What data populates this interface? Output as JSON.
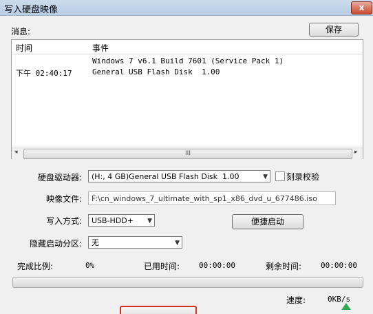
{
  "window": {
    "title": "写入硬盘映像",
    "close_glyph": "x"
  },
  "messages": {
    "label": "消息:",
    "save_label": "保存",
    "columns": [
      "时间",
      "事件"
    ],
    "rows": [
      {
        "time": "",
        "event": "Windows 7 v6.1 Build 7601 (Service Pack 1)"
      },
      {
        "time": "下午 02:40:17",
        "event": "General USB Flash Disk  1.00"
      }
    ],
    "scroll_glyph": "III"
  },
  "form": {
    "drive_label": "硬盘驱动器:",
    "drive_value": "(H:, 4 GB)General USB Flash Disk  1.00",
    "verify_label": "刻录校验",
    "image_label": "映像文件:",
    "image_value": "F:\\cn_windows_7_ultimate_with_sp1_x86_dvd_u_677486.iso",
    "method_label": "写入方式:",
    "method_value": "USB-HDD+",
    "quick_boot_label": "便捷启动",
    "hidden_label": "隐藏启动分区:",
    "hidden_value": "无"
  },
  "status": {
    "progress_label": "完成比例:",
    "progress_value": "0%",
    "progress_fraction": 0,
    "elapsed_label": "已用时间:",
    "elapsed_value": "00:00:00",
    "remaining_label": "剩余时间:",
    "remaining_value": "00:00:00",
    "speed_label": "速度:",
    "speed_value": "0KB/s"
  }
}
